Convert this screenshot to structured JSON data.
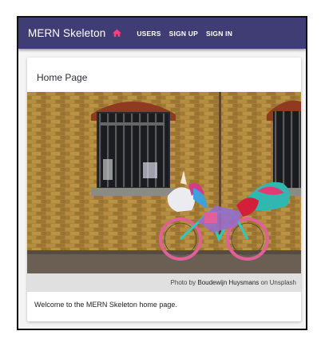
{
  "appbar": {
    "brand": "MERN Skeleton",
    "home_icon": "home-icon",
    "links": [
      "USERS",
      "SIGN UP",
      "SIGN IN"
    ]
  },
  "card": {
    "title": "Home Page",
    "image_icon": "unicorn-bicycle-photo",
    "caption": {
      "prefix": "Photo by ",
      "author": "Boudewijn Huysmans",
      "suffix": " on Unsplash"
    },
    "welcome_text": "Welcome to the MERN Skeleton home page."
  },
  "colors": {
    "appbar": "#3f3d73",
    "home_icon": "#ff4081",
    "caption_bg": "#e0e0e0"
  }
}
